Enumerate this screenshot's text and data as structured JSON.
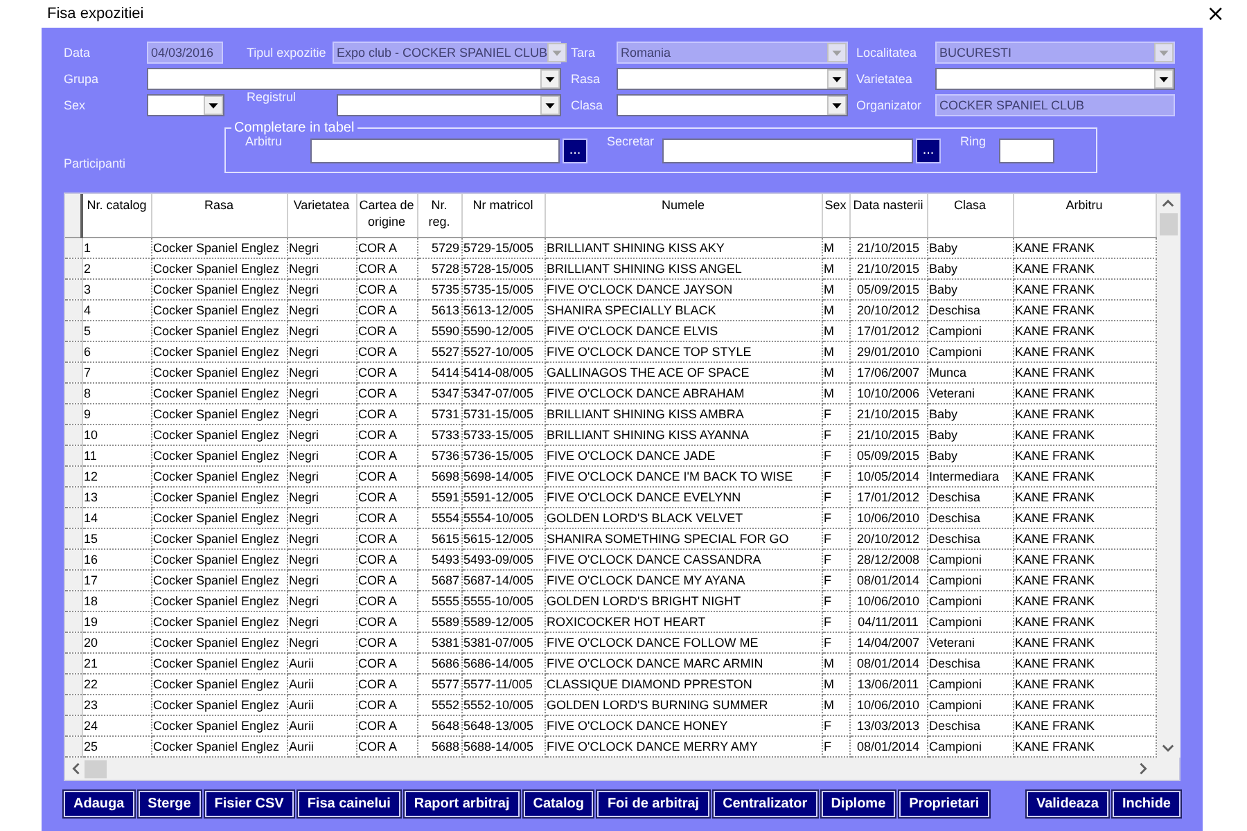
{
  "window": {
    "title": "Fisa expozitiei",
    "close": "×"
  },
  "form": {
    "fields": [
      {
        "label": "Data",
        "kind": "text",
        "value": "04/03/2016",
        "disabled": true
      },
      {
        "label": "Tipul expozitie",
        "kind": "dropdown",
        "value": "Expo club - COCKER SPANIEL CLUB",
        "disabled": true
      },
      {
        "label": "Tara",
        "kind": "dropdown",
        "value": "Romania",
        "disabled": true
      },
      {
        "label": "Localitatea",
        "kind": "dropdown",
        "value": "BUCURESTI",
        "disabled": true
      },
      {
        "label": "Grupa",
        "kind": "dropdown",
        "disabled": false
      },
      {
        "label": "Rasa",
        "kind": "dropdown",
        "disabled": false
      },
      {
        "label": "Varietatea",
        "kind": "dropdown",
        "disabled": false
      },
      {
        "label": "Sex",
        "kind": "dropdown",
        "disabled": false
      },
      {
        "label": "Registrul",
        "kind": "dropdown",
        "disabled": false
      },
      {
        "label": "Clasa",
        "kind": "dropdown",
        "disabled": false
      },
      {
        "label": "Organizator",
        "kind": "text",
        "value": "COCKER SPANIEL CLUB",
        "disabled": true
      }
    ],
    "participants_label": "Participanti",
    "group": {
      "title": "Completare in tabel",
      "fields": [
        {
          "label": "Arbitru",
          "kind": "picker",
          "button_text": "..."
        },
        {
          "label": "Secretar",
          "kind": "picker",
          "button_text": "..."
        },
        {
          "label": "Ring",
          "kind": "text"
        }
      ]
    }
  },
  "table": {
    "columns": [
      "Nr. catalog",
      "Rasa",
      "Varietatea",
      "Cartea de origine",
      "Nr. reg.",
      "Nr matricol",
      "Numele",
      "Sex",
      "Data nasterii",
      "Clasa",
      "Arbitru"
    ],
    "rows": [
      [
        "1",
        "Cocker Spaniel Englez",
        "Negri",
        "COR A",
        "5729",
        "5729-15/005",
        "BRILLIANT SHINING KISS AKY",
        "M",
        "21/10/2015",
        "Baby",
        "KANE FRANK"
      ],
      [
        "2",
        "Cocker Spaniel Englez",
        "Negri",
        "COR A",
        "5728",
        "5728-15/005",
        "BRILLIANT SHINING KISS ANGEL",
        "M",
        "21/10/2015",
        "Baby",
        "KANE FRANK"
      ],
      [
        "3",
        "Cocker Spaniel Englez",
        "Negri",
        "COR A",
        "5735",
        "5735-15/005",
        "FIVE O'CLOCK DANCE JAYSON",
        "M",
        "05/09/2015",
        "Baby",
        "KANE FRANK"
      ],
      [
        "4",
        "Cocker Spaniel Englez",
        "Negri",
        "COR A",
        "5613",
        "5613-12/005",
        "SHANIRA SPECIALLY BLACK",
        "M",
        "20/10/2012",
        "Deschisa",
        "KANE FRANK"
      ],
      [
        "5",
        "Cocker Spaniel Englez",
        "Negri",
        "COR A",
        "5590",
        "5590-12/005",
        "FIVE O'CLOCK DANCE ELVIS",
        "M",
        "17/01/2012",
        "Campioni",
        "KANE FRANK"
      ],
      [
        "6",
        "Cocker Spaniel Englez",
        "Negri",
        "COR A",
        "5527",
        "5527-10/005",
        "FIVE O'CLOCK DANCE TOP STYLE",
        "M",
        "29/01/2010",
        "Campioni",
        "KANE FRANK"
      ],
      [
        "7",
        "Cocker Spaniel Englez",
        "Negri",
        "COR A",
        "5414",
        "5414-08/005",
        "GALLINAGOS THE ACE OF SPACE",
        "M",
        "17/06/2007",
        "Munca",
        "KANE FRANK"
      ],
      [
        "8",
        "Cocker Spaniel Englez",
        "Negri",
        "COR A",
        "5347",
        "5347-07/005",
        "FIVE O'CLOCK DANCE ABRAHAM",
        "M",
        "10/10/2006",
        "Veterani",
        "KANE FRANK"
      ],
      [
        "9",
        "Cocker Spaniel Englez",
        "Negri",
        "COR A",
        "5731",
        "5731-15/005",
        "BRILLIANT SHINING KISS AMBRA",
        "F",
        "21/10/2015",
        "Baby",
        "KANE FRANK"
      ],
      [
        "10",
        "Cocker Spaniel Englez",
        "Negri",
        "COR A",
        "5733",
        "5733-15/005",
        "BRILLIANT SHINING KISS AYANNA",
        "F",
        "21/10/2015",
        "Baby",
        "KANE FRANK"
      ],
      [
        "11",
        "Cocker Spaniel Englez",
        "Negri",
        "COR A",
        "5736",
        "5736-15/005",
        "FIVE O'CLOCK DANCE JADE",
        "F",
        "05/09/2015",
        "Baby",
        "KANE FRANK"
      ],
      [
        "12",
        "Cocker Spaniel Englez",
        "Negri",
        "COR A",
        "5698",
        "5698-14/005",
        "FIVE O'CLOCK DANCE I'M BACK TO WISE",
        "F",
        "10/05/2014",
        "Intermediara",
        "KANE FRANK"
      ],
      [
        "13",
        "Cocker Spaniel Englez",
        "Negri",
        "COR A",
        "5591",
        "5591-12/005",
        "FIVE O'CLOCK DANCE EVELYNN",
        "F",
        "17/01/2012",
        "Deschisa",
        "KANE FRANK"
      ],
      [
        "14",
        "Cocker Spaniel Englez",
        "Negri",
        "COR A",
        "5554",
        "5554-10/005",
        "GOLDEN LORD'S BLACK VELVET",
        "F",
        "10/06/2010",
        "Deschisa",
        "KANE FRANK"
      ],
      [
        "15",
        "Cocker Spaniel Englez",
        "Negri",
        "COR A",
        "5615",
        "5615-12/005",
        "SHANIRA SOMETHING SPECIAL FOR GO",
        "F",
        "20/10/2012",
        "Deschisa",
        "KANE FRANK"
      ],
      [
        "16",
        "Cocker Spaniel Englez",
        "Negri",
        "COR A",
        "5493",
        "5493-09/005",
        "FIVE O'CLOCK DANCE CASSANDRA",
        "F",
        "28/12/2008",
        "Campioni",
        "KANE FRANK"
      ],
      [
        "17",
        "Cocker Spaniel Englez",
        "Negri",
        "COR A",
        "5687",
        "5687-14/005",
        "FIVE O'CLOCK DANCE MY AYANA",
        "F",
        "08/01/2014",
        "Campioni",
        "KANE FRANK"
      ],
      [
        "18",
        "Cocker Spaniel Englez",
        "Negri",
        "COR A",
        "5555",
        "5555-10/005",
        "GOLDEN LORD'S BRIGHT NIGHT",
        "F",
        "10/06/2010",
        "Campioni",
        "KANE FRANK"
      ],
      [
        "19",
        "Cocker Spaniel Englez",
        "Negri",
        "COR A",
        "5589",
        "5589-12/005",
        "ROXICOCKER HOT HEART",
        "F",
        "04/11/2011",
        "Campioni",
        "KANE FRANK"
      ],
      [
        "20",
        "Cocker Spaniel Englez",
        "Negri",
        "COR A",
        "5381",
        "5381-07/005",
        "FIVE O'CLOCK DANCE FOLLOW ME",
        "F",
        "14/04/2007",
        "Veterani",
        "KANE FRANK"
      ],
      [
        "21",
        "Cocker Spaniel Englez",
        "Aurii",
        "COR A",
        "5686",
        "5686-14/005",
        "FIVE O'CLOCK DANCE MARC ARMIN",
        "M",
        "08/01/2014",
        "Deschisa",
        "KANE FRANK"
      ],
      [
        "22",
        "Cocker Spaniel Englez",
        "Aurii",
        "COR A",
        "5577",
        "5577-11/005",
        "CLASSIQUE DIAMOND PPRESTON",
        "M",
        "13/06/2011",
        "Campioni",
        "KANE FRANK"
      ],
      [
        "23",
        "Cocker Spaniel Englez",
        "Aurii",
        "COR A",
        "5552",
        "5552-10/005",
        "GOLDEN LORD'S BURNING SUMMER",
        "M",
        "10/06/2010",
        "Campioni",
        "KANE FRANK"
      ],
      [
        "24",
        "Cocker Spaniel Englez",
        "Aurii",
        "COR A",
        "5648",
        "5648-13/005",
        "FIVE O'CLOCK DANCE HONEY",
        "F",
        "13/03/2013",
        "Deschisa",
        "KANE FRANK"
      ],
      [
        "25",
        "Cocker Spaniel Englez",
        "Aurii",
        "COR A",
        "5688",
        "5688-14/005",
        "FIVE O'CLOCK DANCE MERRY AMY",
        "F",
        "08/01/2014",
        "Campioni",
        "KANE FRANK"
      ]
    ]
  },
  "buttons": [
    "Adauga",
    "Sterge",
    "Fisier CSV",
    "Fisa cainelui",
    "Raport arbitraj",
    "Catalog",
    "Foi de arbitraj",
    "Centralizator",
    "Diplome",
    "Proprietari"
  ],
  "right_buttons": [
    "Valideaza",
    "Inchide"
  ]
}
